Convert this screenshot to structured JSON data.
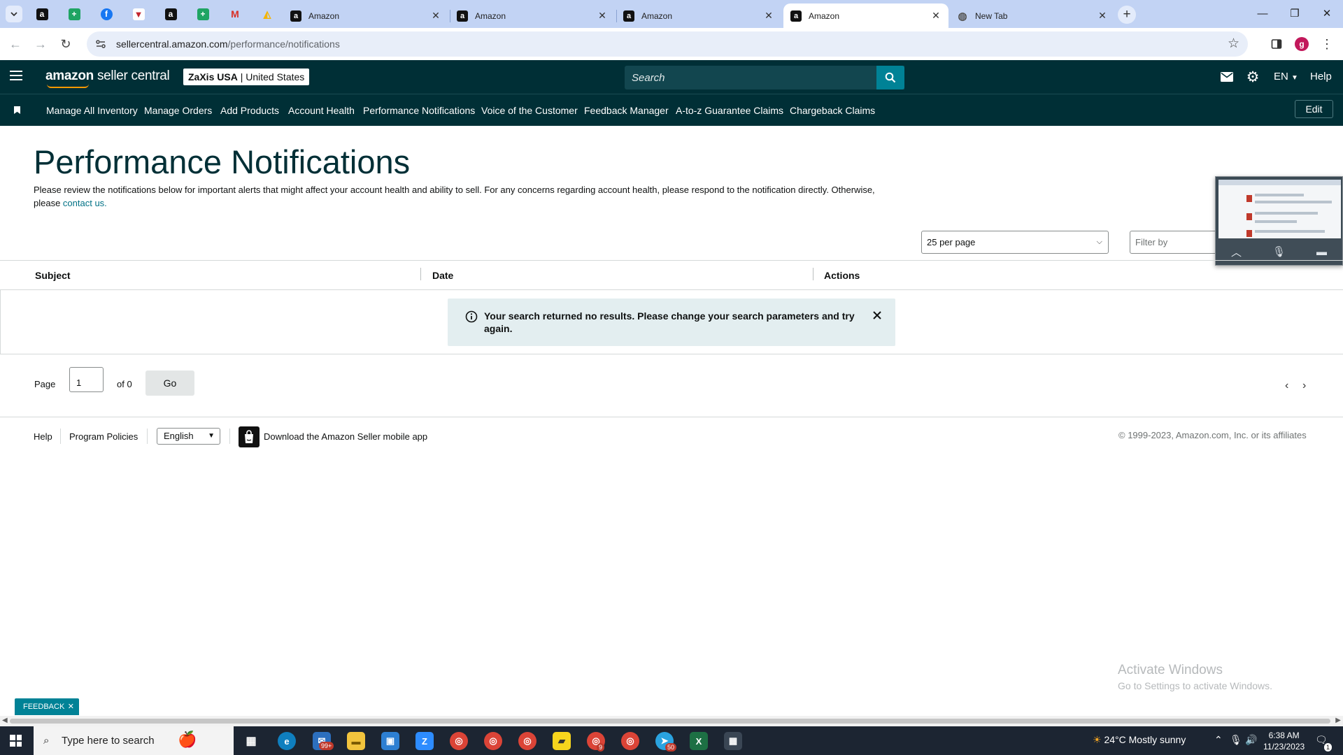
{
  "browser": {
    "tabs": [
      {
        "title": "Amazon",
        "active": false
      },
      {
        "title": "Amazon",
        "active": false
      },
      {
        "title": "Amazon",
        "active": false
      },
      {
        "title": "Amazon",
        "active": true
      },
      {
        "title": "New Tab",
        "active": false
      }
    ],
    "url_domain": "sellercentral.amazon.com",
    "url_path": "/performance/notifications",
    "profile_initial": "g"
  },
  "header": {
    "logo_brand": "amazon",
    "logo_product": "seller central",
    "account_name": "ZaXis USA",
    "account_region": "United States",
    "search_placeholder": "Search",
    "language": "EN",
    "help": "Help"
  },
  "nav": {
    "items": [
      "Manage All Inventory",
      "Manage Orders",
      "Add Products",
      "Account Health",
      "Performance Notifications",
      "Voice of the Customer",
      "Feedback Manager",
      "A-to-z Guarantee Claims",
      "Chargeback Claims"
    ],
    "edit": "Edit"
  },
  "main": {
    "title": "Performance Notifications",
    "intro_text": "Please review the notifications below for important alerts that might affect your account health and ability to sell. For any concerns regarding account health, please respond to the notification directly. Otherwise, please ",
    "intro_link": "contact us.",
    "per_page": "25 per page",
    "filter_placeholder": "Filter by",
    "columns": [
      "Subject",
      "Date",
      "Actions"
    ],
    "alert_message": "Your search returned no results. Please change your search parameters and try again.",
    "pager": {
      "label": "Page",
      "current": "1",
      "of_text": "of 0",
      "go": "Go"
    }
  },
  "footer": {
    "help": "Help",
    "program_policies": "Program Policies",
    "language": "English",
    "app_link": "Download the Amazon Seller mobile app",
    "copyright": "© 1999-2023, Amazon.com, Inc. or its affiliates"
  },
  "watermark": {
    "title": "Activate Windows",
    "subtitle": "Go to Settings to activate Windows."
  },
  "feedback_tab": "FEEDBACK",
  "taskbar": {
    "search_text": "Type here to search",
    "mail_badge": "99+",
    "chrome_badge": "9",
    "telegram_badge": "50",
    "weather": "24°C  Mostly sunny",
    "time": "6:38 AM",
    "date": "11/23/2023",
    "notifications_count": "1"
  },
  "colors": {
    "header_bg": "#002f36",
    "accent_teal": "#008296",
    "link": "#007185",
    "alert_bg": "#e3eef0"
  }
}
